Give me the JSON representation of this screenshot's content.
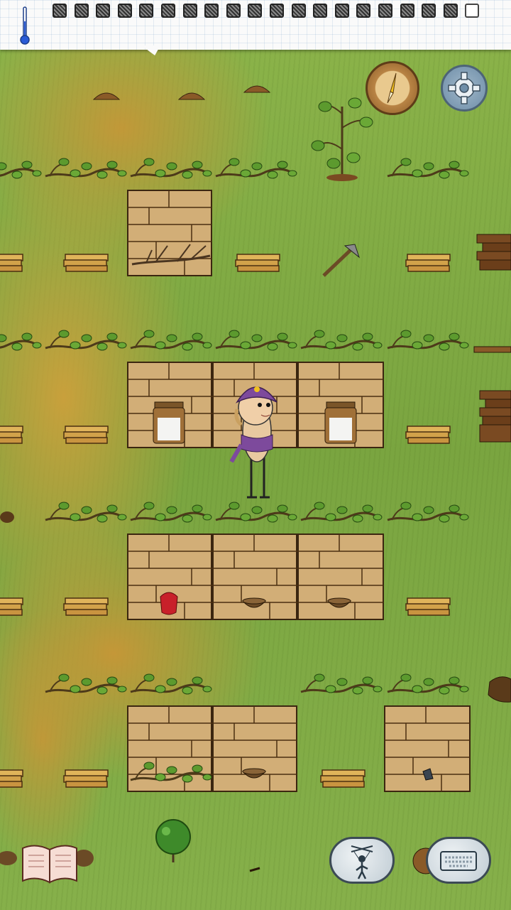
{
  "game": {
    "screen": "crafting-ground",
    "inventory_slots": {
      "filled": 19,
      "empty": 1
    },
    "buttons": {
      "compass": "compass-icon",
      "settings": "gear-icon",
      "recipe_book": "open-book-icon",
      "puppet": "puppet-icon",
      "keyboard": "keyboard-icon"
    },
    "character": {
      "headwear": "purple-turban"
    },
    "colors": {
      "grass": "#7fa83f",
      "dry_grass": "#cfa03c",
      "crate_wood": "#d2ae77",
      "turban": "#7d4a9c",
      "bubble": "#c7d2d9"
    }
  }
}
